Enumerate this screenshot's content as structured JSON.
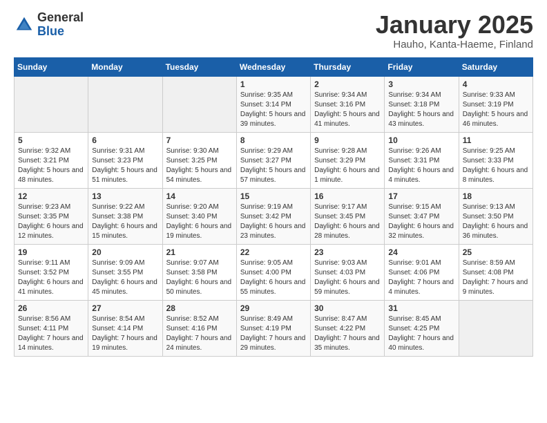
{
  "header": {
    "logo_general": "General",
    "logo_blue": "Blue",
    "month_title": "January 2025",
    "location": "Hauho, Kanta-Haeme, Finland"
  },
  "weekdays": [
    "Sunday",
    "Monday",
    "Tuesday",
    "Wednesday",
    "Thursday",
    "Friday",
    "Saturday"
  ],
  "weeks": [
    [
      {
        "day": "",
        "info": ""
      },
      {
        "day": "",
        "info": ""
      },
      {
        "day": "",
        "info": ""
      },
      {
        "day": "1",
        "info": "Sunrise: 9:35 AM\nSunset: 3:14 PM\nDaylight: 5 hours and 39 minutes."
      },
      {
        "day": "2",
        "info": "Sunrise: 9:34 AM\nSunset: 3:16 PM\nDaylight: 5 hours and 41 minutes."
      },
      {
        "day": "3",
        "info": "Sunrise: 9:34 AM\nSunset: 3:18 PM\nDaylight: 5 hours and 43 minutes."
      },
      {
        "day": "4",
        "info": "Sunrise: 9:33 AM\nSunset: 3:19 PM\nDaylight: 5 hours and 46 minutes."
      }
    ],
    [
      {
        "day": "5",
        "info": "Sunrise: 9:32 AM\nSunset: 3:21 PM\nDaylight: 5 hours and 48 minutes."
      },
      {
        "day": "6",
        "info": "Sunrise: 9:31 AM\nSunset: 3:23 PM\nDaylight: 5 hours and 51 minutes."
      },
      {
        "day": "7",
        "info": "Sunrise: 9:30 AM\nSunset: 3:25 PM\nDaylight: 5 hours and 54 minutes."
      },
      {
        "day": "8",
        "info": "Sunrise: 9:29 AM\nSunset: 3:27 PM\nDaylight: 5 hours and 57 minutes."
      },
      {
        "day": "9",
        "info": "Sunrise: 9:28 AM\nSunset: 3:29 PM\nDaylight: 6 hours and 1 minute."
      },
      {
        "day": "10",
        "info": "Sunrise: 9:26 AM\nSunset: 3:31 PM\nDaylight: 6 hours and 4 minutes."
      },
      {
        "day": "11",
        "info": "Sunrise: 9:25 AM\nSunset: 3:33 PM\nDaylight: 6 hours and 8 minutes."
      }
    ],
    [
      {
        "day": "12",
        "info": "Sunrise: 9:23 AM\nSunset: 3:35 PM\nDaylight: 6 hours and 12 minutes."
      },
      {
        "day": "13",
        "info": "Sunrise: 9:22 AM\nSunset: 3:38 PM\nDaylight: 6 hours and 15 minutes."
      },
      {
        "day": "14",
        "info": "Sunrise: 9:20 AM\nSunset: 3:40 PM\nDaylight: 6 hours and 19 minutes."
      },
      {
        "day": "15",
        "info": "Sunrise: 9:19 AM\nSunset: 3:42 PM\nDaylight: 6 hours and 23 minutes."
      },
      {
        "day": "16",
        "info": "Sunrise: 9:17 AM\nSunset: 3:45 PM\nDaylight: 6 hours and 28 minutes."
      },
      {
        "day": "17",
        "info": "Sunrise: 9:15 AM\nSunset: 3:47 PM\nDaylight: 6 hours and 32 minutes."
      },
      {
        "day": "18",
        "info": "Sunrise: 9:13 AM\nSunset: 3:50 PM\nDaylight: 6 hours and 36 minutes."
      }
    ],
    [
      {
        "day": "19",
        "info": "Sunrise: 9:11 AM\nSunset: 3:52 PM\nDaylight: 6 hours and 41 minutes."
      },
      {
        "day": "20",
        "info": "Sunrise: 9:09 AM\nSunset: 3:55 PM\nDaylight: 6 hours and 45 minutes."
      },
      {
        "day": "21",
        "info": "Sunrise: 9:07 AM\nSunset: 3:58 PM\nDaylight: 6 hours and 50 minutes."
      },
      {
        "day": "22",
        "info": "Sunrise: 9:05 AM\nSunset: 4:00 PM\nDaylight: 6 hours and 55 minutes."
      },
      {
        "day": "23",
        "info": "Sunrise: 9:03 AM\nSunset: 4:03 PM\nDaylight: 6 hours and 59 minutes."
      },
      {
        "day": "24",
        "info": "Sunrise: 9:01 AM\nSunset: 4:06 PM\nDaylight: 7 hours and 4 minutes."
      },
      {
        "day": "25",
        "info": "Sunrise: 8:59 AM\nSunset: 4:08 PM\nDaylight: 7 hours and 9 minutes."
      }
    ],
    [
      {
        "day": "26",
        "info": "Sunrise: 8:56 AM\nSunset: 4:11 PM\nDaylight: 7 hours and 14 minutes."
      },
      {
        "day": "27",
        "info": "Sunrise: 8:54 AM\nSunset: 4:14 PM\nDaylight: 7 hours and 19 minutes."
      },
      {
        "day": "28",
        "info": "Sunrise: 8:52 AM\nSunset: 4:16 PM\nDaylight: 7 hours and 24 minutes."
      },
      {
        "day": "29",
        "info": "Sunrise: 8:49 AM\nSunset: 4:19 PM\nDaylight: 7 hours and 29 minutes."
      },
      {
        "day": "30",
        "info": "Sunrise: 8:47 AM\nSunset: 4:22 PM\nDaylight: 7 hours and 35 minutes."
      },
      {
        "day": "31",
        "info": "Sunrise: 8:45 AM\nSunset: 4:25 PM\nDaylight: 7 hours and 40 minutes."
      },
      {
        "day": "",
        "info": ""
      }
    ]
  ]
}
